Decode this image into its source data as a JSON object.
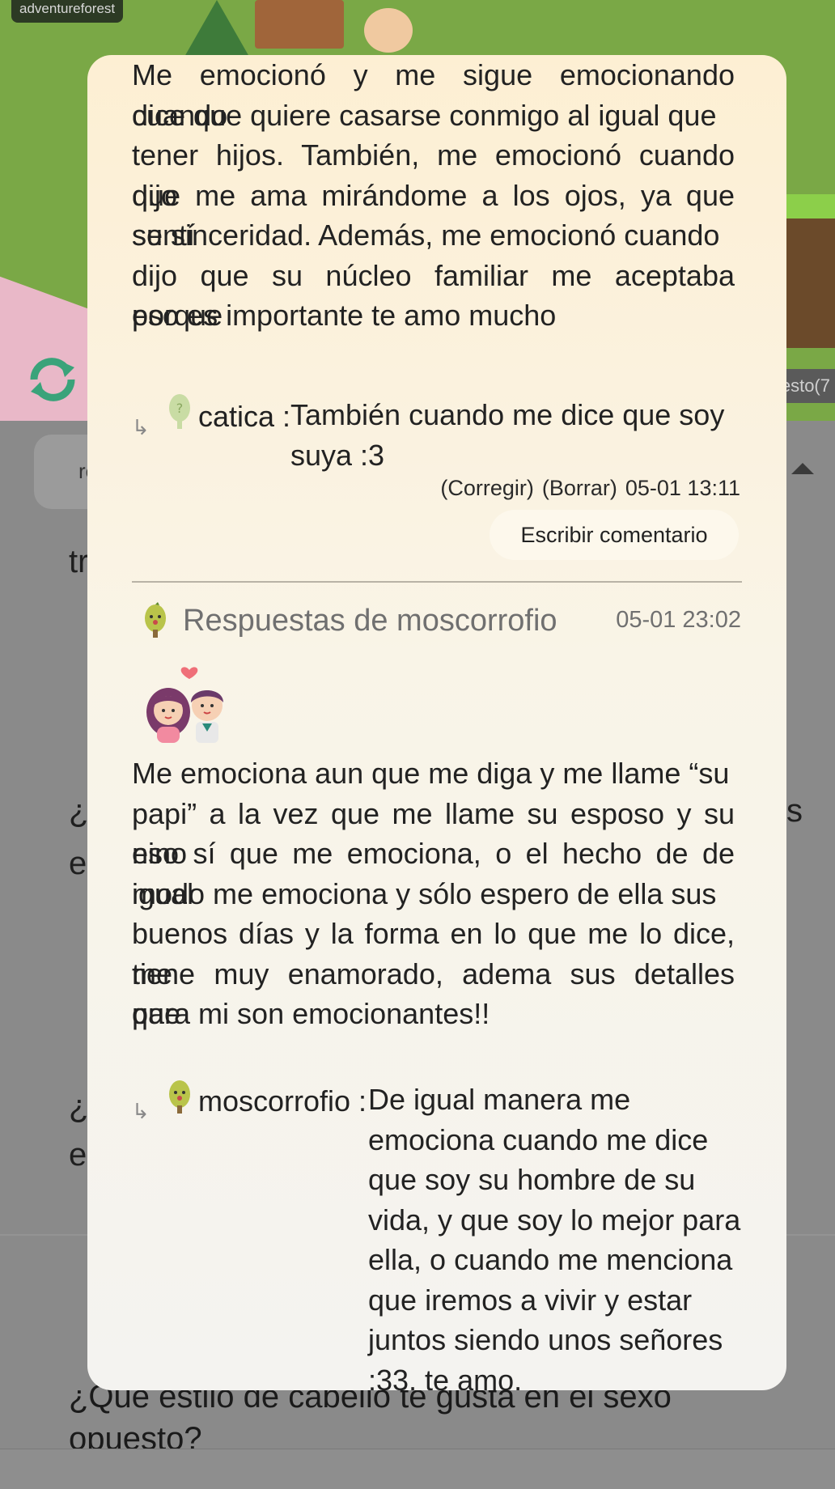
{
  "background": {
    "username_tag": "adventureforest",
    "gesture_tag": "esto(7",
    "tab_pill_label": "re",
    "fragments": {
      "f1": "tr",
      "f2": "¿",
      "f3": "e",
      "f4": "s",
      "f5": "¿",
      "f6": "e"
    },
    "question": "¿Que estilo de cabello te gusta en el sexo opuesto?"
  },
  "post": {
    "lines": [
      "Me emocionó y me sigue emocionando cuando",
      "dice que quiere casarse conmigo al igual que",
      "tener hijos. También, me emocionó cuando dijo",
      "que me ama mirándome a los ojos, ya que sentí",
      "su sinceridad.  Además, me emocionó cuando",
      "dijo que su núcleo familiar me aceptaba porque",
      "eso es importante te amo mucho"
    ]
  },
  "comment1": {
    "user": "catica :",
    "text_lines": [
      "También cuando me dice que soy",
      "suya :3"
    ],
    "edit_label": "(Corregir)",
    "delete_label": "(Borrar)",
    "timestamp": "05-01 13:11"
  },
  "write_comment_label": "Escribir comentario",
  "response": {
    "title": "Respuestas de moscorrofio",
    "date": "05-01 23:02",
    "lines": [
      "Me emociona aun que me diga y me llame “su",
      "papi” a la vez que me llame su esposo y su nino",
      "eso sí que me emociona, o el hecho de de igual",
      "modo me emociona y sólo espero de ella sus",
      "buenos días y la forma en lo que me lo dice, me",
      "tiene muy enamorado, adema sus detalles que",
      "para mi son emocionantes!!"
    ]
  },
  "comment2": {
    "user": "moscorrofio :",
    "text_lines": [
      "De igual manera me",
      "emociona cuando me dice",
      "que soy su hombre de su",
      "vida, y que soy lo mejor para",
      "ella, o cuando me menciona",
      "que iremos a vivir y estar",
      "juntos siendo unos señores",
      ":33, te amo."
    ]
  },
  "icons": {
    "reply_arrow": "↳",
    "unknown_avatar": "?"
  },
  "colors": {
    "modal_top": "#fdefd3",
    "modal_bottom": "#f4f3f0",
    "muted_text": "#707070",
    "refresh_green": "#3aa37a"
  }
}
